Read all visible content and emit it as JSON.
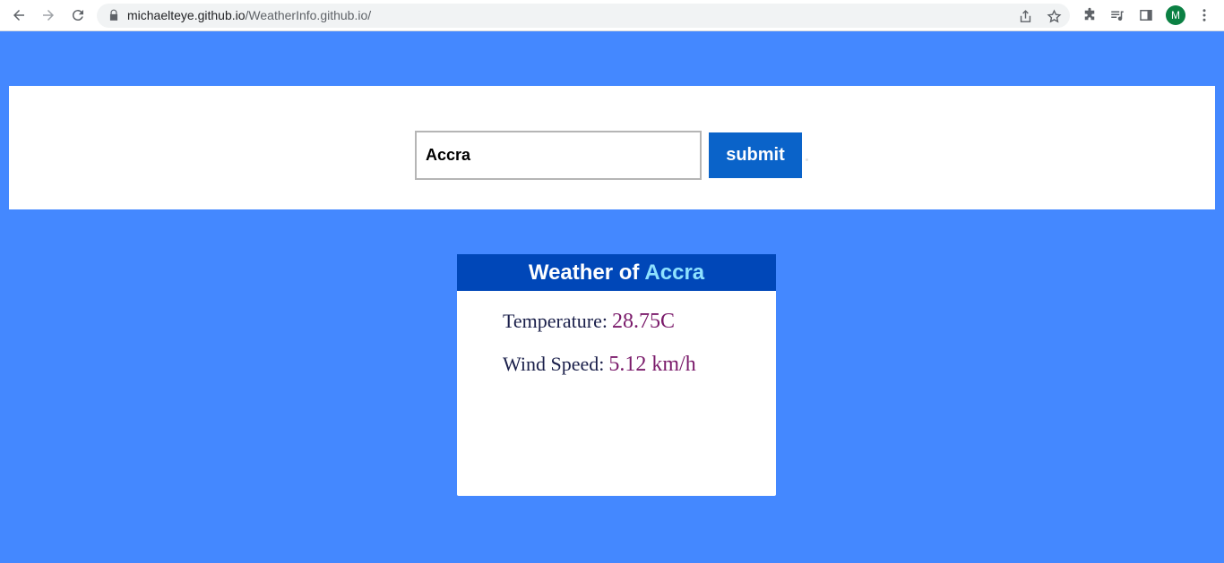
{
  "browser": {
    "url_host": "michaelteye.github.io",
    "url_path": "/WeatherInfo.github.io/",
    "profile_initial": "M",
    "icons": [
      "back-icon",
      "forward-icon",
      "reload-icon",
      "lock-icon",
      "share-icon",
      "star-icon",
      "extensions-icon",
      "media-icon",
      "side-panel-icon",
      "menu-icon"
    ]
  },
  "search": {
    "value": "Accra",
    "submit_label": "submit"
  },
  "card": {
    "title_prefix": "Weather of",
    "city": "Accra",
    "temperature_label": "Temperature:",
    "temperature_value": "28.75C",
    "wind_label": "Wind Speed:",
    "wind_value": "5.12 km/h"
  },
  "colors": {
    "page_background": "#4488ff",
    "card_header": "#0047b8",
    "submit_button": "#0a63c9",
    "city_highlight": "#8ee2ff",
    "value_text": "#7a1a6a"
  }
}
